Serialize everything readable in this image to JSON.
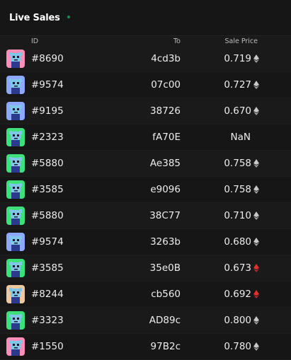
{
  "header": {
    "title": "Live Sales",
    "live_dot_color": "#1f8a5a"
  },
  "columns": {
    "id": "ID",
    "to": "To",
    "price": "Sale Price"
  },
  "rows": [
    {
      "id": "#8690",
      "to": "4cd3b",
      "price": "0.719",
      "currency_icon": "eth-icon",
      "icon_color": "#c8c8c8",
      "avatar_bg": "#ff8fb8"
    },
    {
      "id": "#9574",
      "to": "07c00",
      "price": "0.727",
      "currency_icon": "eth-icon",
      "icon_color": "#c8c8c8",
      "avatar_bg": "#8fa8ff"
    },
    {
      "id": "#9195",
      "to": "38726",
      "price": "0.670",
      "currency_icon": "eth-icon",
      "icon_color": "#c8c8c8",
      "avatar_bg": "#8fa8ff"
    },
    {
      "id": "#2323",
      "to": "fA70E",
      "price": "NaN",
      "currency_icon": "",
      "icon_color": "",
      "avatar_bg": "#3ee07a"
    },
    {
      "id": "#5880",
      "to": "Ae385",
      "price": "0.758",
      "currency_icon": "eth-icon",
      "icon_color": "#c8c8c8",
      "avatar_bg": "#3ee07a"
    },
    {
      "id": "#3585",
      "to": "e9096",
      "price": "0.758",
      "currency_icon": "eth-icon",
      "icon_color": "#c8c8c8",
      "avatar_bg": "#3ee07a"
    },
    {
      "id": "#5880",
      "to": "38C77",
      "price": "0.710",
      "currency_icon": "eth-icon",
      "icon_color": "#c8c8c8",
      "avatar_bg": "#3ee07a"
    },
    {
      "id": "#9574",
      "to": "3263b",
      "price": "0.680",
      "currency_icon": "eth-icon",
      "icon_color": "#c8c8c8",
      "avatar_bg": "#8fa8ff"
    },
    {
      "id": "#3585",
      "to": "35e0B",
      "price": "0.673",
      "currency_icon": "eth-icon",
      "icon_color": "#e03030",
      "avatar_bg": "#3ee07a"
    },
    {
      "id": "#8244",
      "to": "cb560",
      "price": "0.692",
      "currency_icon": "eth-icon",
      "icon_color": "#e03030",
      "avatar_bg": "#f0c8a0"
    },
    {
      "id": "#3323",
      "to": "AD89c",
      "price": "0.800",
      "currency_icon": "eth-icon",
      "icon_color": "#c8c8c8",
      "avatar_bg": "#3ee07a"
    },
    {
      "id": "#1550",
      "to": "97B2c",
      "price": "0.780",
      "currency_icon": "eth-icon",
      "icon_color": "#c8c8c8",
      "avatar_bg": "#ff8fb8"
    }
  ]
}
